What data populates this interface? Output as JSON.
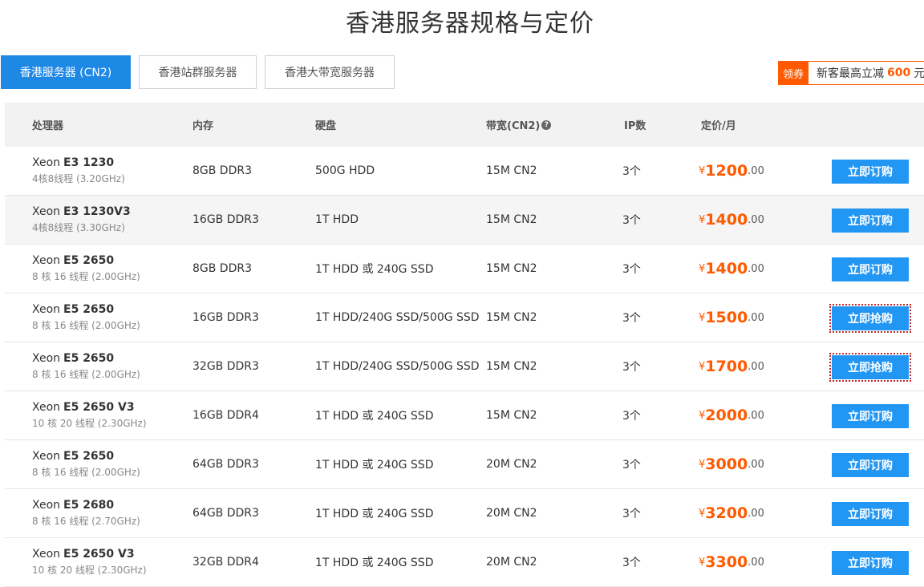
{
  "title": "香港服务器规格与定价",
  "tabs": [
    {
      "label": "香港服务器 (CN2)",
      "active": true
    },
    {
      "label": "香港站群服务器",
      "active": false
    },
    {
      "label": "香港大带宽服务器",
      "active": false
    }
  ],
  "coupon": {
    "tag": "领券",
    "prefix": "新客最高立减",
    "amount": "600",
    "unit": "元"
  },
  "headers": {
    "cpu": "处理器",
    "ram": "内存",
    "disk": "硬盘",
    "bandwidth": "带宽(CN2)",
    "ip": "IP数",
    "price": "定价/月"
  },
  "rows": [
    {
      "brand": "Xeon",
      "model": "E3 1230",
      "spec": "4核8线程 (3.20GHz)",
      "ram": "8GB DDR3",
      "disk": "500G HDD",
      "bandwidth": "15M CN2",
      "ip": "3个",
      "currency": "¥",
      "price_int": "1200",
      "price_dec": ".00",
      "button": "立即订购",
      "flash": false
    },
    {
      "brand": "Xeon",
      "model": "E3 1230V3",
      "spec": "4核8线程 (3.30GHz)",
      "ram": "16GB DDR3",
      "disk": "1T HDD",
      "bandwidth": "15M CN2",
      "ip": "3个",
      "currency": "¥",
      "price_int": "1400",
      "price_dec": ".00",
      "button": "立即订购",
      "flash": false
    },
    {
      "brand": "Xeon",
      "model": "E5 2650",
      "spec": "8 核 16 线程 (2.00GHz)",
      "ram": "8GB DDR3",
      "disk": "1T HDD 或 240G SSD",
      "bandwidth": "15M CN2",
      "ip": "3个",
      "currency": "¥",
      "price_int": "1400",
      "price_dec": ".00",
      "button": "立即订购",
      "flash": false
    },
    {
      "brand": "Xeon",
      "model": "E5 2650",
      "spec": "8 核 16 线程 (2.00GHz)",
      "ram": "16GB DDR3",
      "disk": "1T HDD/240G SSD/500G SSD",
      "bandwidth": "15M CN2",
      "ip": "3个",
      "currency": "¥",
      "price_int": "1500",
      "price_dec": ".00",
      "button": "立即抢购",
      "flash": true
    },
    {
      "brand": "Xeon",
      "model": "E5 2650",
      "spec": "8 核 16 线程 (2.00GHz)",
      "ram": "32GB DDR3",
      "disk": "1T HDD/240G SSD/500G SSD",
      "bandwidth": "15M CN2",
      "ip": "3个",
      "currency": "¥",
      "price_int": "1700",
      "price_dec": ".00",
      "button": "立即抢购",
      "flash": true
    },
    {
      "brand": "Xeon",
      "model": "E5 2650 V3",
      "spec": "10 核 20 线程 (2.30GHz)",
      "ram": "16GB DDR4",
      "disk": "1T HDD 或 240G SSD",
      "bandwidth": "15M CN2",
      "ip": "3个",
      "currency": "¥",
      "price_int": "2000",
      "price_dec": ".00",
      "button": "立即订购",
      "flash": false
    },
    {
      "brand": "Xeon",
      "model": "E5 2650",
      "spec": "8 核 16 线程 (2.00GHz)",
      "ram": "64GB DDR3",
      "disk": "1T HDD 或 240G SSD",
      "bandwidth": "20M CN2",
      "ip": "3个",
      "currency": "¥",
      "price_int": "3000",
      "price_dec": ".00",
      "button": "立即订购",
      "flash": false
    },
    {
      "brand": "Xeon",
      "model": "E5 2680",
      "spec": "8 核 16 线程 (2.70GHz)",
      "ram": "64GB DDR3",
      "disk": "1T HDD 或 240G SSD",
      "bandwidth": "20M CN2",
      "ip": "3个",
      "currency": "¥",
      "price_int": "3200",
      "price_dec": ".00",
      "button": "立即订购",
      "flash": false
    },
    {
      "brand": "Xeon",
      "model": "E5 2650 V3",
      "spec": "10 核 20 线程 (2.30GHz)",
      "ram": "32GB DDR4",
      "disk": "1T HDD 或 240G SSD",
      "bandwidth": "20M CN2",
      "ip": "3个",
      "currency": "¥",
      "price_int": "3300",
      "price_dec": ".00",
      "button": "立即订购",
      "flash": false
    }
  ]
}
